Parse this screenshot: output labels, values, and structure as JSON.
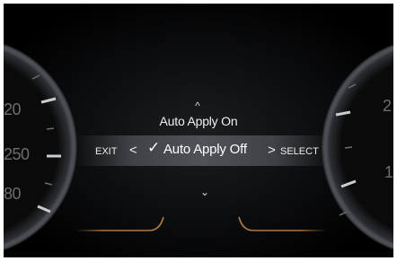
{
  "menu": {
    "up_arrow": "^",
    "option_above": "Auto Apply On",
    "exit_label": "EXIT",
    "left_arrow": "<",
    "check_mark": "✓",
    "current_option": "Auto Apply Off",
    "right_arrow": ">",
    "select_label": "SELECT",
    "down_arrow": "⌄"
  },
  "gauges": {
    "left_labels": [
      "20",
      "250",
      "80"
    ],
    "right_labels": [
      "2",
      "1"
    ]
  },
  "colors": {
    "accent": "#c58a4e",
    "text": "#ffffff",
    "highlight_bar": "#52555a",
    "gauge_bezel": "#3a3d42"
  },
  "icons": {
    "up": "chevron-up-icon",
    "down": "chevron-down-icon",
    "left": "arrow-left-icon",
    "right": "arrow-right-icon",
    "check": "check-icon"
  }
}
